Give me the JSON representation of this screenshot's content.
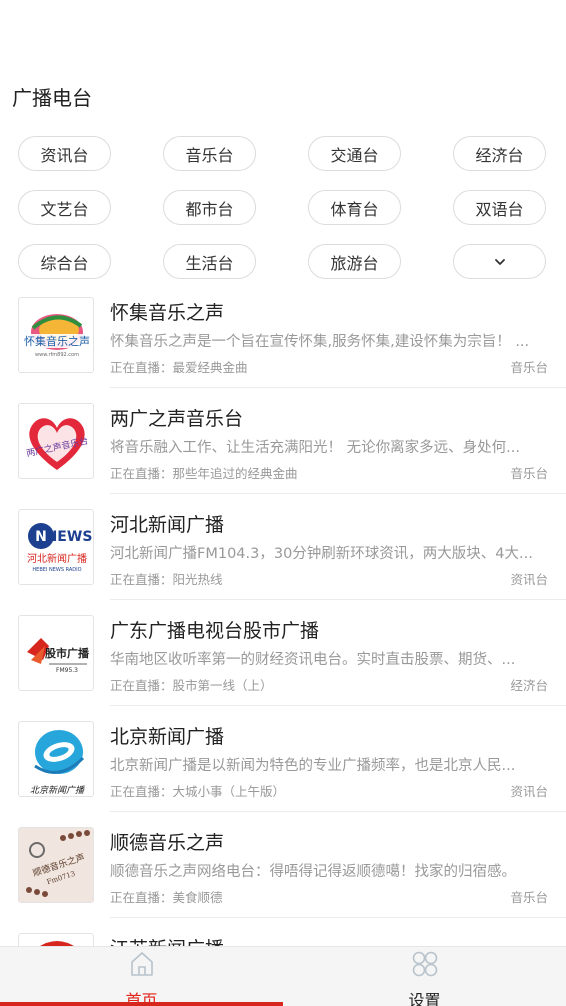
{
  "page_title": "广播电台",
  "categories": [
    "资讯台",
    "音乐台",
    "交通台",
    "经济台",
    "文艺台",
    "都市台",
    "体育台",
    "双语台",
    "综合台",
    "生活台",
    "旅游台"
  ],
  "expand_icon": "chevron-down-icon",
  "stations": [
    {
      "name": "怀集音乐之声",
      "desc": "怀集音乐之声是一个旨在宣传怀集,服务怀集,建设怀集为宗旨！ ...",
      "live": "正在直播：最爱经典金曲",
      "category": "音乐台",
      "logo_text": "怀集音乐之声",
      "logo_sub": "www.rfm892.com"
    },
    {
      "name": "两广之声音乐台",
      "desc": "将音乐融入工作、让生活充满阳光！ 无论你离家多远、身处何...",
      "live": "正在直播：那些年追过的经典金曲",
      "category": "音乐台",
      "logo_text": "两广之声音乐台"
    },
    {
      "name": "河北新闻广播",
      "desc": "河北新闻广播FM104.3，30分钟刷新环球资讯，两大版块、4大...",
      "live": "正在直播：阳光热线",
      "category": "资讯台",
      "logo_text": "NEWS",
      "logo_sub": "河北新闻广播",
      "logo_sub2": "HEBEI NEWS RADIO"
    },
    {
      "name": "广东广播电视台股市广播",
      "desc": "华南地区收听率第一的财经资讯电台。实时直击股票、期货、...",
      "live": "正在直播：股市第一线（上）",
      "category": "经济台",
      "logo_text": "股市广播",
      "logo_sub": "FM95.3"
    },
    {
      "name": "北京新闻广播",
      "desc": "北京新闻广播是以新闻为特色的专业广播频率，也是北京人民...",
      "live": "正在直播：大城小事（上午版）",
      "category": "资讯台",
      "logo_text": "北京新闻广播"
    },
    {
      "name": "顺德音乐之声",
      "desc": "顺德音乐之声网络电台：得唔得记得返顺德噶！找家的归宿感。",
      "live": "正在直播：美食顺德",
      "category": "音乐台",
      "logo_text": "顺德音乐之声",
      "logo_sub": "Fm0713"
    },
    {
      "name": "江苏新闻广播",
      "desc": "",
      "live": "",
      "category": ""
    }
  ],
  "tabbar": {
    "home_label": "首页",
    "home_icon": "home-icon",
    "settings_label": "设置",
    "settings_icon": "settings-icon"
  },
  "colors": {
    "accent": "#d7261e",
    "text_muted": "#999999",
    "chip_border": "#dcdcdc"
  }
}
